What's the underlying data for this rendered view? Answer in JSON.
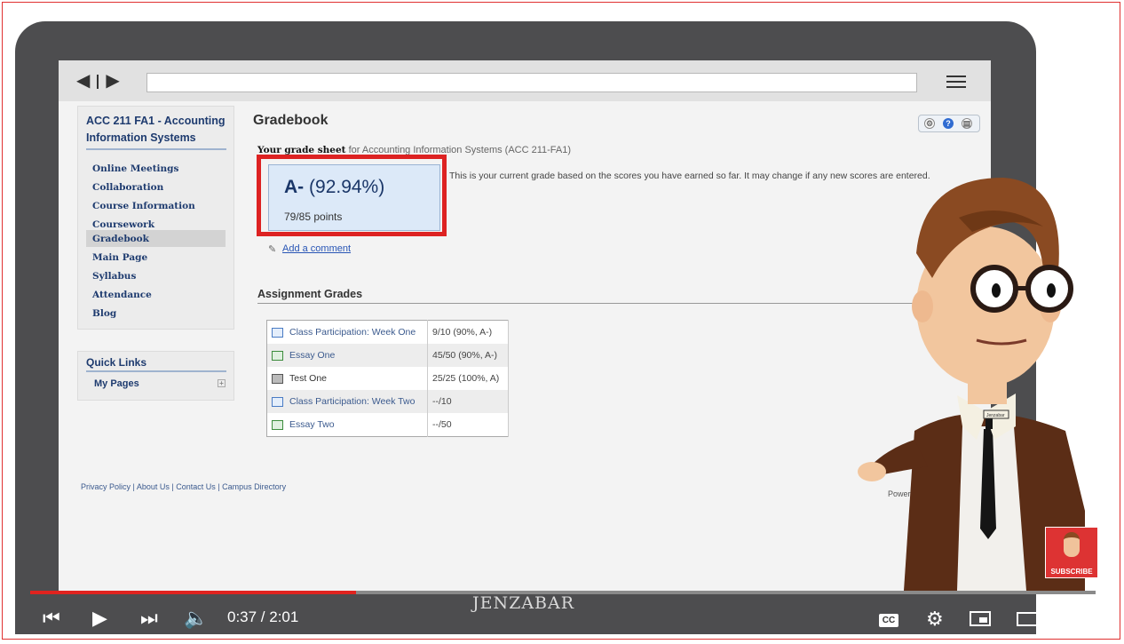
{
  "browser": {
    "nav_back_icon": "triangle-left-icon",
    "nav_forward_icon": "triangle-right-icon",
    "menu_icon": "hamburger-icon"
  },
  "sidebar": {
    "course_title": "ACC 211 FA1 - Accounting Information Systems",
    "items": [
      {
        "label": "Online Meetings"
      },
      {
        "label": "Collaboration"
      },
      {
        "label": "Course Information"
      },
      {
        "label": "Coursework"
      },
      {
        "label": "Gradebook",
        "active": true
      },
      {
        "label": "Main Page"
      },
      {
        "label": "Syllabus"
      },
      {
        "label": "Attendance"
      },
      {
        "label": "Blog"
      }
    ],
    "quick_links_title": "Quick Links",
    "quick_links": [
      {
        "label": "My Pages"
      }
    ]
  },
  "gradebook": {
    "title": "Gradebook",
    "grade_sheet_label": "Your grade sheet",
    "grade_sheet_suffix": " for Accounting Information Systems (ACC 211-FA1)",
    "grade_letter": "A-",
    "grade_percent": "(92.94%)",
    "points": "79/85 points",
    "description": "This is your current grade based on the scores you have earned so far. It may change if any new scores are entered.",
    "add_comment": "Add a comment",
    "assignments_title": "Assignment Grades",
    "assignments": [
      {
        "name": "Class Participation: Week One",
        "score": "9/10 (90%, A-)",
        "icon": "forum-icon"
      },
      {
        "name": "Essay One",
        "score": "45/50 (90%, A-)",
        "icon": "document-icon"
      },
      {
        "name": "Test One",
        "score": "25/25 (100%, A)",
        "icon": "test-icon"
      },
      {
        "name": "Class Participation: Week Two",
        "score": "--/10",
        "icon": "forum-icon"
      },
      {
        "name": "Essay Two",
        "score": "--/50",
        "icon": "document-icon"
      }
    ]
  },
  "footer": {
    "links": "Privacy Policy | About Us | Contact Us | Campus Directory",
    "powered_by": "Powered by Jenzabar. v8"
  },
  "video": {
    "current_time": "0:37",
    "total_time": "2:01",
    "time_display": "0:37 / 2:01",
    "progress_fraction": 0.306,
    "logo": "JENZABAR",
    "cc_label": "CC",
    "subscribe_label": "SUBSCRIBE",
    "badge_text": "Jenzabar",
    "accent_color": "#e0231f"
  }
}
